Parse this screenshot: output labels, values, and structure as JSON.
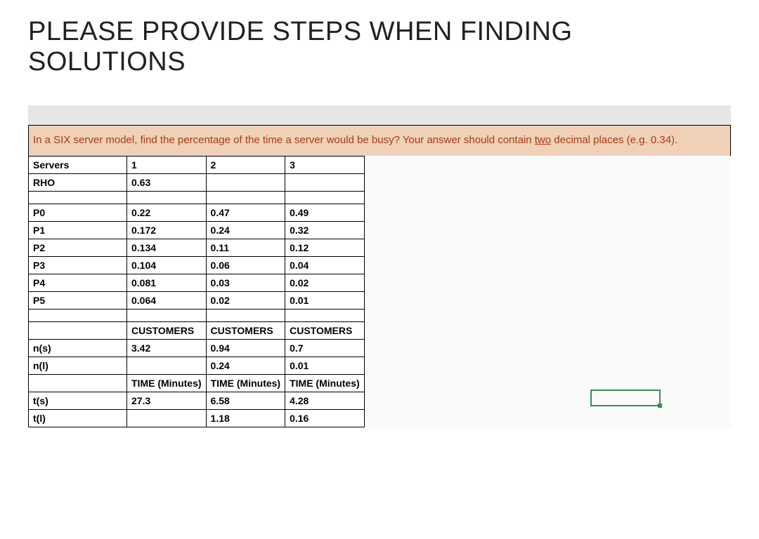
{
  "title": "PLEASE PROVIDE STEPS WHEN FINDING SOLUTIONS",
  "question": {
    "prefix": "In a SIX server model, find the percentage of the time a server would be busy? Your answer should contain ",
    "underlined": "two",
    "suffix": " decimal places (e.g. 0.34)."
  },
  "headers": {
    "servers_label": "Servers",
    "rho_label": "RHO",
    "col1": "1",
    "col2": "2",
    "col3": "3",
    "rho1": "0.63"
  },
  "probs": {
    "P0": {
      "label": "P0",
      "c1": "0.22",
      "c2": "0.47",
      "c3": "0.49"
    },
    "P1": {
      "label": "P1",
      "c1": "0.172",
      "c2": "0.24",
      "c3": "0.32"
    },
    "P2": {
      "label": "P2",
      "c1": "0.134",
      "c2": "0.11",
      "c3": "0.12"
    },
    "P3": {
      "label": "P3",
      "c1": "0.104",
      "c2": "0.06",
      "c3": "0.04"
    },
    "P4": {
      "label": "P4",
      "c1": "0.081",
      "c2": "0.03",
      "c3": "0.02"
    },
    "P5": {
      "label": "P5",
      "c1": "0.064",
      "c2": "0.02",
      "c3": "0.01"
    }
  },
  "customers": {
    "header1": "CUSTOMERS",
    "header2": "CUSTOMERS",
    "header3": "CUSTOMERS",
    "ns_label": "n(s)",
    "nl_label": "n(l)",
    "ns": {
      "c1": "3.42",
      "c2": "0.94",
      "c3": "0.7"
    },
    "nl": {
      "c1": "",
      "c2": "0.24",
      "c3": "0.01"
    }
  },
  "time": {
    "header1": "TIME (Minutes)",
    "header2": "TIME (Minutes)",
    "header3": "TIME (Minutes)",
    "ts_label": "t(s)",
    "tl_label": "t(l)",
    "ts": {
      "c1": "27.3",
      "c2": "6.58",
      "c3": "4.28"
    },
    "tl": {
      "c1": "",
      "c2": "1.18",
      "c3": "0.16"
    }
  }
}
